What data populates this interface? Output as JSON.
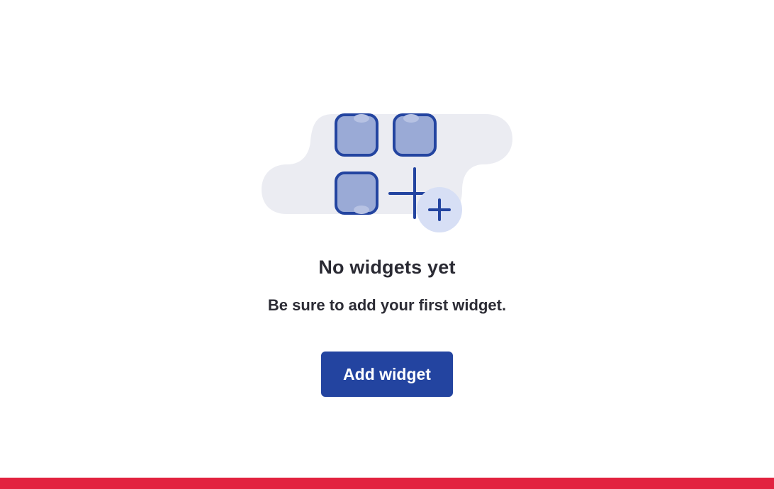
{
  "empty_state": {
    "illustration_icon": "widgets-grid-add-icon",
    "title": "No widgets yet",
    "subtitle": "Be sure to add your first widget.",
    "button_label": "Add widget"
  },
  "colors": {
    "primary": "#2344a0",
    "tile_fill": "#9aaad6",
    "cloud": "#ebecf2",
    "badge": "#d7dff5",
    "footer_bar": "#e2223f",
    "text": "#2a2a33"
  }
}
